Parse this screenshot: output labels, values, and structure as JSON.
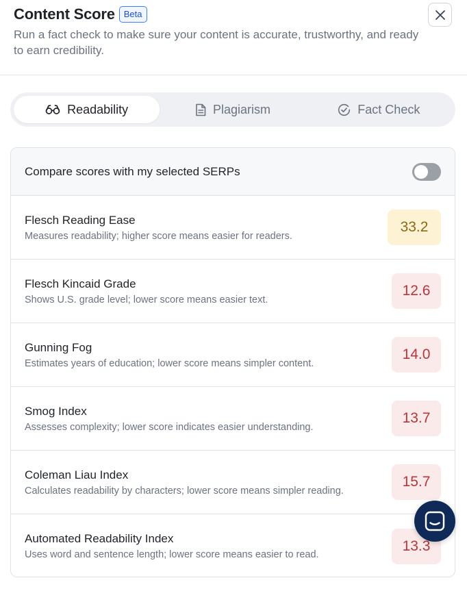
{
  "header": {
    "title": "Content Score",
    "badge": "Beta",
    "subtitle": "Run a fact check to make sure your content is accurate, trustworthy, and ready to earn credibility."
  },
  "tabs": [
    {
      "label": "Readability",
      "icon": "glasses-icon",
      "active": true
    },
    {
      "label": "Plagiarism",
      "icon": "document-icon",
      "active": false
    },
    {
      "label": "Fact Check",
      "icon": "check-circle-icon",
      "active": false
    }
  ],
  "compare": {
    "label": "Compare scores with my selected SERPs",
    "enabled": false
  },
  "metrics": [
    {
      "name": "Flesch Reading Ease",
      "description": "Measures readability; higher score means easier for readers.",
      "score": "33.2",
      "status": "warn"
    },
    {
      "name": "Flesch Kincaid Grade",
      "description": "Shows U.S. grade level; lower score means easier text.",
      "score": "12.6",
      "status": "bad"
    },
    {
      "name": "Gunning Fog",
      "description": "Estimates years of education; lower score means simpler content.",
      "score": "14.0",
      "status": "bad"
    },
    {
      "name": "Smog Index",
      "description": "Assesses complexity; lower score indicates easier understanding.",
      "score": "13.7",
      "status": "bad"
    },
    {
      "name": "Coleman Liau Index",
      "description": "Calculates readability by characters; lower score means simpler reading.",
      "score": "15.7",
      "status": "bad"
    },
    {
      "name": "Automated Readability Index",
      "description": "Uses word and sentence length; lower score means easier to read.",
      "score": "13.3",
      "status": "bad"
    }
  ],
  "colors": {
    "warn_bg": "#fdf3d4",
    "warn_text": "#8a6914",
    "bad_bg": "#fbeaea",
    "bad_text": "#b3373b",
    "chat_fab": "#0f2a57"
  },
  "chat": {
    "icon": "chat-icon"
  }
}
